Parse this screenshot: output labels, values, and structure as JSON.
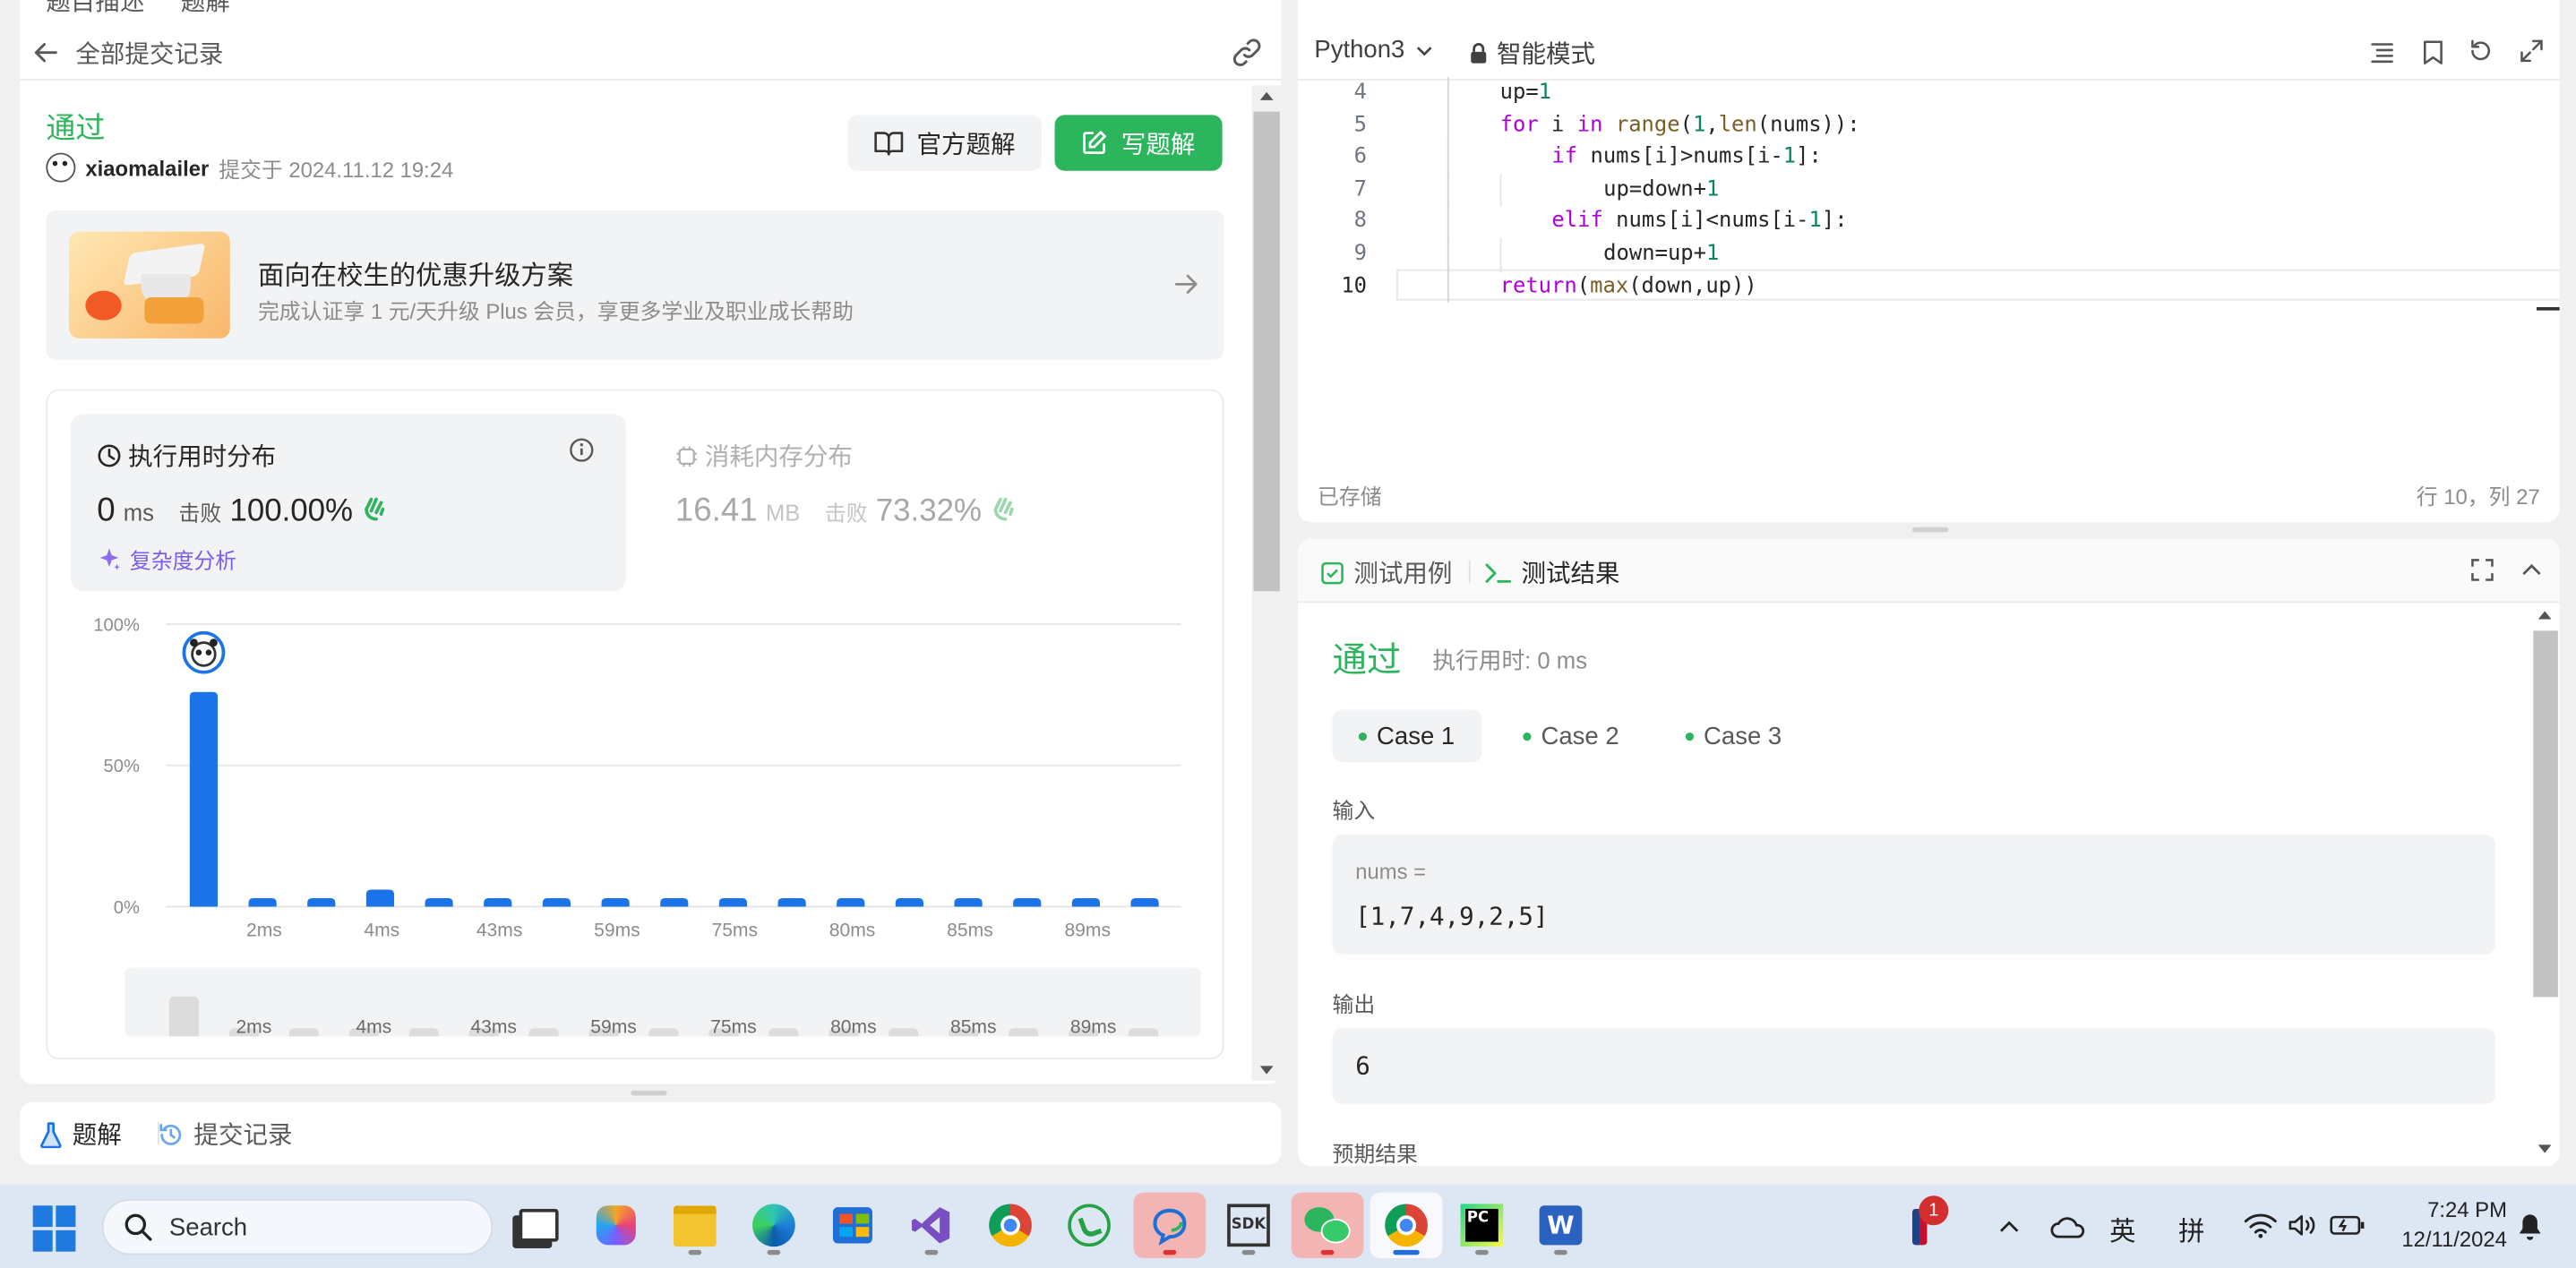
{
  "left": {
    "top_tabs": [
      "题目描述",
      "题解"
    ],
    "back_label": "全部提交记录",
    "status": "通过",
    "user": "xiaomalailer",
    "submitted_at": "提交于 2024.11.12 19:24",
    "official_solution_btn": "官方题解",
    "write_solution_btn": "写题解",
    "promo": {
      "title": "面向在校生的优惠升级方案",
      "subtitle": "完成认证享 1 元/天升级 Plus 会员，享更多学业及职业成长帮助"
    },
    "runtime": {
      "title": "执行用时分布",
      "value": "0",
      "unit": "ms",
      "beats_label": "击败",
      "beats": "100.00%",
      "complexity": "复杂度分析"
    },
    "memory": {
      "title": "消耗内存分布",
      "value": "16.41",
      "unit": "MB",
      "beats_label": "击败",
      "beats": "73.32%"
    },
    "bottom_tabs": [
      "题解",
      "提交记录"
    ]
  },
  "chart_data": {
    "type": "bar",
    "title": "执行用时分布",
    "ylim": [
      0,
      100
    ],
    "y_ticks": [
      "100%",
      "50%",
      "0%"
    ],
    "x_tick_labels": [
      "2ms",
      "4ms",
      "43ms",
      "59ms",
      "75ms",
      "80ms",
      "85ms",
      "89ms"
    ],
    "values": [
      76,
      3,
      3,
      6,
      3,
      3,
      3,
      3,
      3,
      3,
      3,
      3,
      3,
      3,
      3,
      3,
      3
    ],
    "highlight_index": 0,
    "bar_color": "#1a73e8",
    "grid": true
  },
  "editor": {
    "language": "Python3",
    "mode": "智能模式",
    "lines": [
      {
        "n": "4",
        "indent": 2,
        "tokens": [
          [
            "up=",
            "p"
          ],
          [
            "1",
            "n"
          ]
        ]
      },
      {
        "n": "5",
        "indent": 2,
        "tokens": [
          [
            "for",
            "k"
          ],
          [
            " i ",
            "p"
          ],
          [
            "in",
            "k"
          ],
          [
            " ",
            "p"
          ],
          [
            "range",
            "f"
          ],
          [
            "(",
            "p"
          ],
          [
            "1",
            "n"
          ],
          [
            ",",
            "p"
          ],
          [
            "len",
            "f"
          ],
          [
            "(nums)):",
            "p"
          ]
        ]
      },
      {
        "n": "6",
        "indent": 3,
        "tokens": [
          [
            "if",
            "k"
          ],
          [
            " nums[i]>nums[i-",
            "p"
          ],
          [
            "1",
            "n"
          ],
          [
            "]:",
            "p"
          ]
        ]
      },
      {
        "n": "7",
        "indent": 4,
        "tokens": [
          [
            "up=down+",
            "p"
          ],
          [
            "1",
            "n"
          ]
        ]
      },
      {
        "n": "8",
        "indent": 3,
        "tokens": [
          [
            "elif",
            "k"
          ],
          [
            " nums[i]<nums[i-",
            "p"
          ],
          [
            "1",
            "n"
          ],
          [
            "]:",
            "p"
          ]
        ]
      },
      {
        "n": "9",
        "indent": 4,
        "tokens": [
          [
            "down=up+",
            "p"
          ],
          [
            "1",
            "n"
          ]
        ]
      },
      {
        "n": "10",
        "indent": 2,
        "tokens": [
          [
            "return",
            "k"
          ],
          [
            "(",
            "p"
          ],
          [
            "max",
            "f"
          ],
          [
            "(down,up))",
            "p"
          ]
        ]
      }
    ],
    "saved": "已存储",
    "position": "行 10，列 27"
  },
  "test": {
    "tab_cases": "测试用例",
    "tab_result": "测试结果",
    "status": "通过",
    "runtime": "执行用时: 0 ms",
    "cases": [
      "Case 1",
      "Case 2",
      "Case 3"
    ],
    "input_label": "输入",
    "param_name": "nums =",
    "param_value": "[1,7,4,9,2,5]",
    "output_label": "输出",
    "output_value": "6",
    "expected_label": "预期结果"
  },
  "taskbar": {
    "search_placeholder": "Search",
    "ime_lang": "英",
    "ime_mode": "拼",
    "notification_count": "1",
    "time": "7:24 PM",
    "date": "12/11/2024"
  },
  "colors": {
    "accent_green": "#2db55d",
    "chart_blue": "#1a73e8",
    "keyword": "#af00db",
    "function": "#795e26",
    "number": "#098658"
  }
}
